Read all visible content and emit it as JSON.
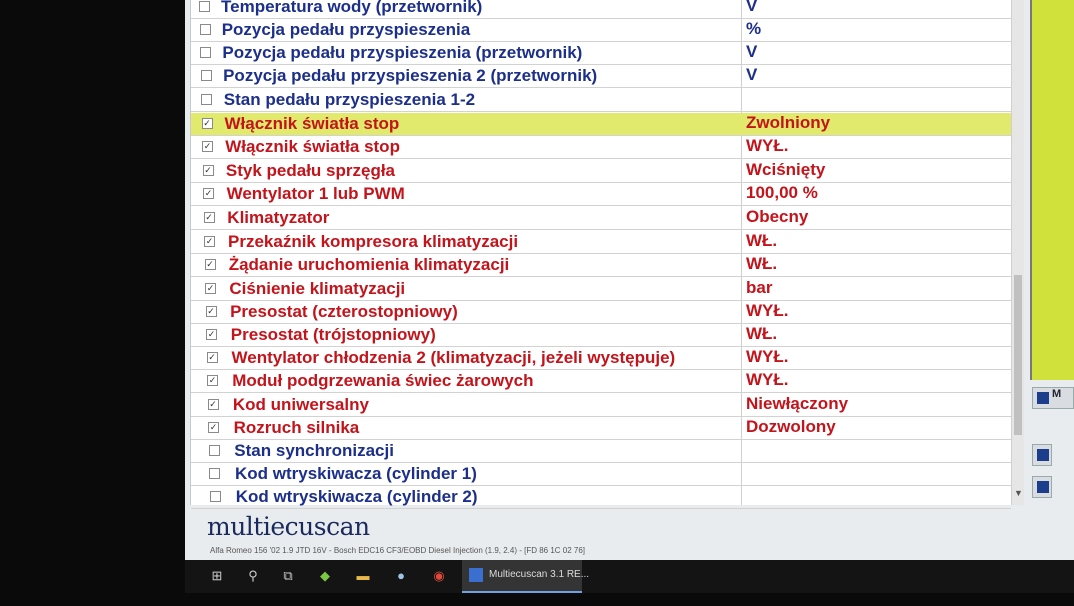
{
  "rows": [
    {
      "name": "Temperatura wody (przetwornik)",
      "value": "V",
      "checked": false
    },
    {
      "name": "Pozycja pedału przyspieszenia",
      "value": "%",
      "checked": false
    },
    {
      "name": "Pozycja pedału przyspieszenia (przetwornik)",
      "value": "V",
      "checked": false
    },
    {
      "name": "Pozycja pedału przyspieszenia 2 (przetwornik)",
      "value": "V",
      "checked": false
    },
    {
      "name": "Stan pedału przyspieszenia 1-2",
      "value": "",
      "checked": false
    },
    {
      "name": "Włącznik światła stop",
      "value": "Zwolniony",
      "checked": true,
      "selected": true
    },
    {
      "name": "Włącznik światła stop",
      "value": "WYŁ.",
      "checked": true
    },
    {
      "name": "Styk pedału sprzęgła",
      "value": "Wciśnięty",
      "checked": true
    },
    {
      "name": "Wentylator 1 lub PWM",
      "value": "100,00 %",
      "checked": true
    },
    {
      "name": "Klimatyzator",
      "value": "Obecny",
      "checked": true
    },
    {
      "name": "Przekaźnik kompresora klimatyzacji",
      "value": "WŁ.",
      "checked": true
    },
    {
      "name": "Żądanie uruchomienia klimatyzacji",
      "value": "WŁ.",
      "checked": true
    },
    {
      "name": "Ciśnienie klimatyzacji",
      "value": " bar",
      "checked": true
    },
    {
      "name": "Presostat (czterostopniowy)",
      "value": "WYŁ.",
      "checked": true
    },
    {
      "name": "Presostat (trójstopniowy)",
      "value": "WŁ.",
      "checked": true
    },
    {
      "name": "Wentylator chłodzenia 2 (klimatyzacji, jeżeli występuje)",
      "value": "WYŁ.",
      "checked": true
    },
    {
      "name": "Moduł podgrzewania świec żarowych",
      "value": "WYŁ.",
      "checked": true
    },
    {
      "name": "Kod uniwersalny",
      "value": "Niewłączony",
      "checked": true
    },
    {
      "name": "Rozruch silnika",
      "value": "Dozwolony",
      "checked": true
    },
    {
      "name": "Stan synchronizacji",
      "value": "",
      "checked": false
    },
    {
      "name": "Kod wtryskiwacza (cylinder 1)",
      "value": "",
      "checked": false
    },
    {
      "name": "Kod wtryskiwacza (cylinder 2)",
      "value": "",
      "checked": false
    }
  ],
  "checkmark_glyph": "☑",
  "logo": "multiecuscan",
  "status_bar": "Alfa Romeo 156 '02 1.9 JTD 16V - Bosch EDC16 CF3/EOBD Diesel Injection (1.9, 2.4) - [FD 86 1C 02 76]",
  "right_panel": {
    "button_label": "M"
  },
  "taskbar": {
    "active_app_label": "Multiecuscan 3.1 RE..."
  },
  "colors": {
    "active_param": "#c4141b",
    "inactive_param": "#1c2f8a",
    "selected_row": "#e2ea6e",
    "right_panel": "#cfe13a"
  }
}
